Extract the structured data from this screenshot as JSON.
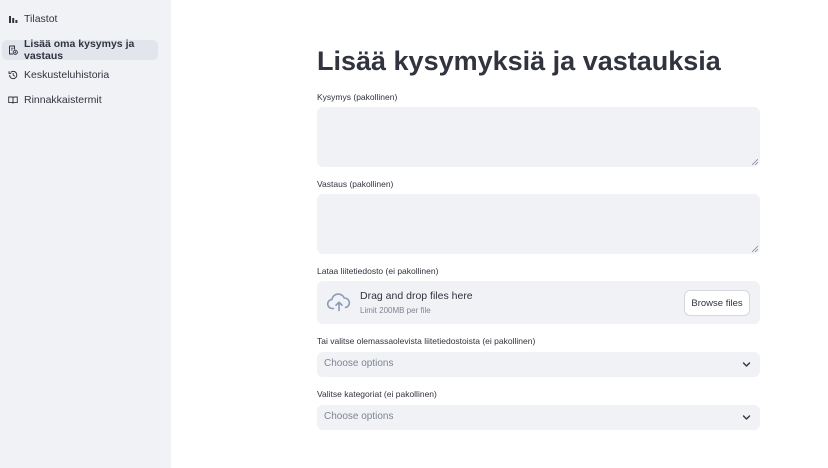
{
  "sidebar": {
    "items": [
      {
        "label": "Tilastot",
        "icon": "bar-chart-icon",
        "active": false
      },
      {
        "label": "Lisää oma kysymys ja vastaus",
        "icon": "add-document-icon",
        "active": true
      },
      {
        "label": "Keskusteluhistoria",
        "icon": "history-icon",
        "active": false
      },
      {
        "label": "Rinnakkaistermit",
        "icon": "book-icon",
        "active": false
      }
    ]
  },
  "main": {
    "title": "Lisää kysymyksiä ja vastauksia",
    "question": {
      "label": "Kysymys (pakollinen)",
      "value": ""
    },
    "answer": {
      "label": "Vastaus (pakollinen)",
      "value": ""
    },
    "upload": {
      "label": "Lataa liitetiedosto (ei pakollinen)",
      "title": "Drag and drop files here",
      "limit": "Limit 200MB per file",
      "button": "Browse files"
    },
    "existing_attachments": {
      "label": "Tai valitse olemassaolevista liitetiedostoista (ei pakollinen)",
      "placeholder": "Choose options"
    },
    "categories": {
      "label": "Valitse kategoriat (ei pakollinen)",
      "placeholder": "Choose options"
    }
  },
  "colors": {
    "sidebar_bg": "#f0f2f6",
    "active_item_bg": "#e2e5ec",
    "text": "#31333f",
    "muted": "#808495"
  }
}
